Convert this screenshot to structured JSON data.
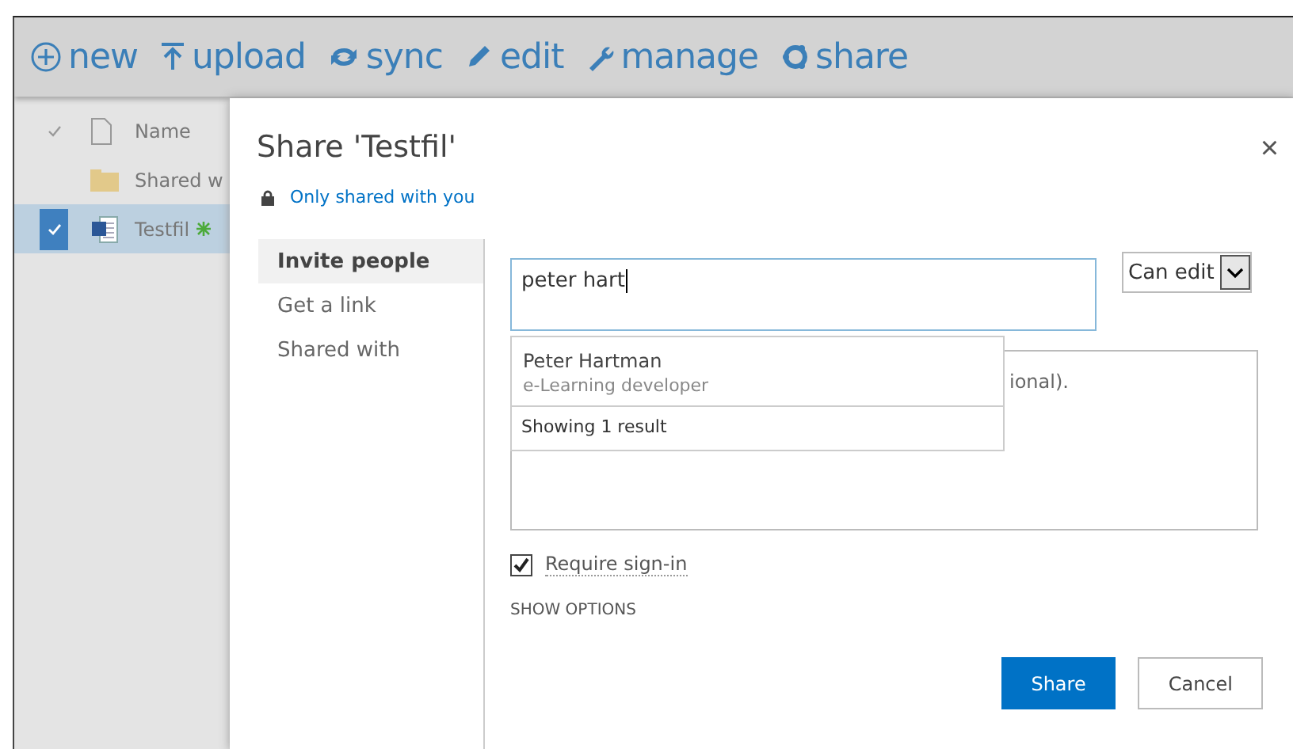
{
  "toolbar": [
    {
      "kind": "new",
      "label": "new"
    },
    {
      "kind": "upload",
      "label": "upload"
    },
    {
      "kind": "sync",
      "label": "sync"
    },
    {
      "kind": "edit",
      "label": "edit"
    },
    {
      "kind": "manage",
      "label": "manage"
    },
    {
      "kind": "share",
      "label": "share"
    }
  ],
  "file_list": {
    "header": "Name",
    "rows": [
      {
        "kind": "folder",
        "name": "Shared w",
        "selected": false
      },
      {
        "kind": "word",
        "name": "Testfil",
        "selected": true,
        "new": true
      }
    ]
  },
  "dialog": {
    "title": "Share 'Testfil'",
    "close": "×",
    "sharing_status": "Only shared with you",
    "nav": [
      {
        "label": "Invite people",
        "selected": true
      },
      {
        "label": "Get a link",
        "selected": false
      },
      {
        "label": "Shared with",
        "selected": false
      }
    ],
    "people_field": {
      "value": "peter hart"
    },
    "permission": {
      "value": "Can edit"
    },
    "suggestions": [
      {
        "name": "Peter Hartman",
        "title": "e-Learning developer"
      }
    ],
    "suggestions_footer": "Showing 1 result",
    "message": {
      "placeholder": "ional)."
    },
    "require_sign_in": {
      "label": "Require sign-in",
      "checked": true
    },
    "show_options": "SHOW OPTIONS",
    "buttons": [
      {
        "label": "Share",
        "kind": "primary"
      },
      {
        "label": "Cancel",
        "kind": "secondary"
      }
    ]
  }
}
